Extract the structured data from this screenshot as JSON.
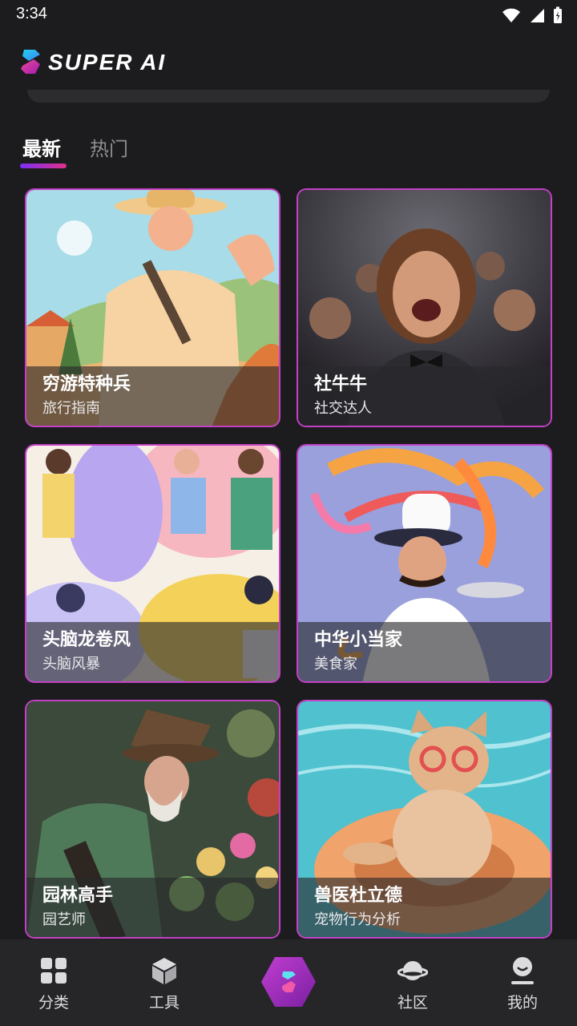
{
  "status_bar": {
    "time": "3:34"
  },
  "header": {
    "app_name": "SUPER AI"
  },
  "tabs": [
    {
      "label": "最新",
      "active": true
    },
    {
      "label": "热门",
      "active": false
    }
  ],
  "cards": [
    {
      "title": "穷游特种兵",
      "subtitle": "旅行指南"
    },
    {
      "title": "社牛牛",
      "subtitle": "社交达人"
    },
    {
      "title": "头脑龙卷风",
      "subtitle": "头脑风暴"
    },
    {
      "title": "中华小当家",
      "subtitle": "美食家"
    },
    {
      "title": "园林高手",
      "subtitle": "园艺师"
    },
    {
      "title": "兽医杜立德",
      "subtitle": "宠物行为分析"
    }
  ],
  "bottom_nav": {
    "category": "分类",
    "tools": "工具",
    "community": "社区",
    "mine": "我的"
  },
  "colors": {
    "accent_purple": "#7b2ff7",
    "accent_pink": "#e0308a",
    "card_border": "#c440c7",
    "background": "#1c1c1e"
  }
}
